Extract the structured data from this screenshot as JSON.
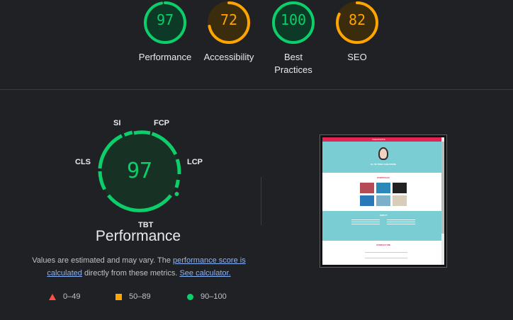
{
  "categories": [
    {
      "label": "Performance",
      "score": "97",
      "level": "pass"
    },
    {
      "label": "Accessibility",
      "score": "72",
      "level": "average"
    },
    {
      "label": "Best Practices",
      "score": "100",
      "level": "pass"
    },
    {
      "label": "SEO",
      "score": "82",
      "level": "average"
    }
  ],
  "colors": {
    "pass": "#0cce6b",
    "average": "#ffa400",
    "fail": "#ff4e42",
    "pass_bg": "#0c3a26",
    "average_bg": "#3a2c0d"
  },
  "performance": {
    "score": "97",
    "title": "Performance",
    "metrics": {
      "si": "SI",
      "fcp": "FCP",
      "lcp": "LCP",
      "tbt": "TBT",
      "cls": "CLS"
    }
  },
  "description": {
    "prefix": "Values are estimated and may vary. The ",
    "link1": "performance score is calculated",
    "middle": " directly from these metrics. ",
    "link2": "See calculator."
  },
  "legend": [
    {
      "range": "0–49",
      "shape": "triangle"
    },
    {
      "range": "50–89",
      "shape": "square"
    },
    {
      "range": "90–100",
      "shape": "circle"
    }
  ],
  "thumbnail": {
    "nav_brand": "CHECKMATE",
    "hero_text": "HI, I'M TREE CHECKSIDE",
    "portfolio_title": "PORTFOLIO",
    "about_title": "ABOUT",
    "contact_title": "CONTACT ME"
  }
}
